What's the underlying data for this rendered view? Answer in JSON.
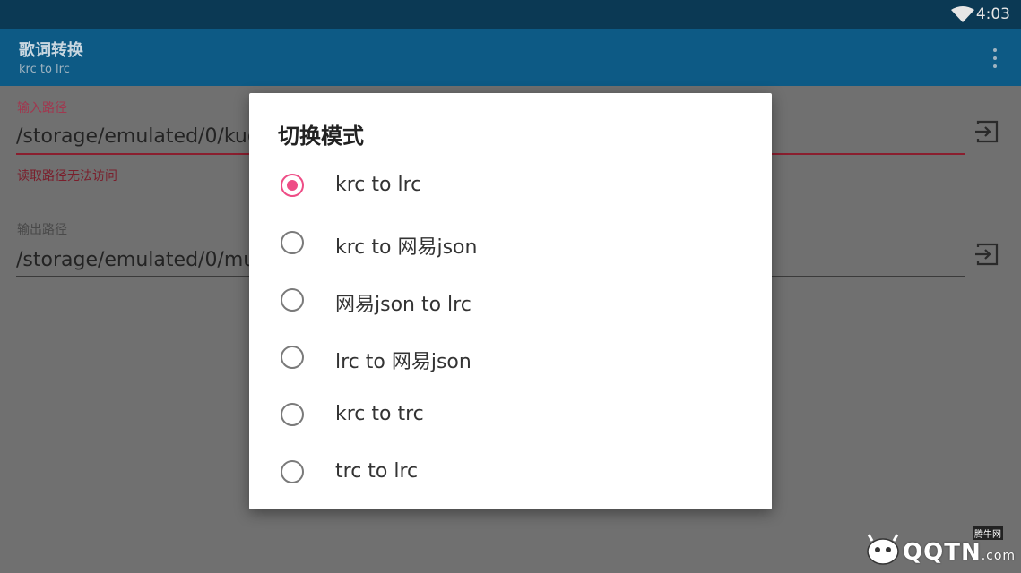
{
  "status_bar": {
    "time": "4:03",
    "wifi_icon": "wifi-icon"
  },
  "app_bar": {
    "title": "歌词转换",
    "subtitle": "krc to lrc",
    "menu_icon": "overflow-menu-icon"
  },
  "content": {
    "input": {
      "label": "输入路径",
      "value": "/storage/emulated/0/kug",
      "error": "读取路径无法访问",
      "icon": "login-icon"
    },
    "output": {
      "label": "输出路径",
      "value": "/storage/emulated/0/mu",
      "icon": "login-icon"
    }
  },
  "dialog": {
    "title": "切换模式",
    "selected_index": 0,
    "options": [
      {
        "label": "krc to lrc",
        "checked": true
      },
      {
        "label": "krc to 网易json",
        "checked": false
      },
      {
        "label": "网易json to lrc",
        "checked": false
      },
      {
        "label": "lrc to 网易json",
        "checked": false
      },
      {
        "label": "krc to trc",
        "checked": false
      },
      {
        "label": "trc to lrc",
        "checked": false
      }
    ]
  },
  "watermark": {
    "text": "QQTN",
    "suffix": ".com",
    "tag": "腾牛网"
  },
  "colors": {
    "status_bar": "#0b3954",
    "app_bar": "#0d5a85",
    "accent": "#ee4d86",
    "error": "#a0384f"
  }
}
